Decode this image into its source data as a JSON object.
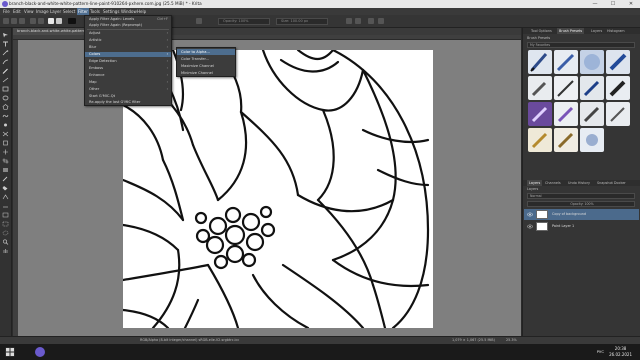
{
  "window": {
    "title": "branch-black-and-white-white-pattern-line-paint-910264-pxhere.com.jpg (25.5 MiB) * - Krita",
    "minimize": "—",
    "maximize": "☐",
    "close": "✕"
  },
  "menubar": {
    "items": [
      "File",
      "Edit",
      "View",
      "Image",
      "Layer",
      "Select",
      "Filter",
      "Tools",
      "Settings",
      "Window",
      "Help"
    ],
    "active": "Filter"
  },
  "toolbar": {
    "opacity_label": "Opacity: 100%",
    "size_label": "Size: 100.00 px"
  },
  "document_tab": {
    "label": "branch-black-and-white-white-pattern-line-paint-910264-pxhere.com.jpg"
  },
  "filter_menu": {
    "apply_again": "Apply Filter Again: Levels",
    "apply_again_shortcut": "Ctrl+F",
    "apply_prompting": "Apply Filter Again (Reprompt)",
    "items": [
      "Adjust",
      "Artistic",
      "Blur",
      "Colors",
      "Edge Detection",
      "Emboss",
      "Enhance",
      "Map",
      "Other",
      "Start G'MIC-Qt",
      "Re-apply the last G'MIC filter"
    ],
    "highlighted": "Colors"
  },
  "colors_submenu": {
    "items": [
      "Color to Alpha...",
      "Color Transfer...",
      "Maximize Channel",
      "Minimize Channel"
    ],
    "highlighted": "Color to Alpha..."
  },
  "dock": {
    "top_tabs": [
      "Tool Options",
      "Brush Presets",
      "Layers",
      "Histogram"
    ],
    "brush_presets_label": "Brush Presets",
    "tag_label": "My Favorites",
    "layer_tabs": [
      "Layers",
      "Channels",
      "Undo History",
      "Snapshot Docker"
    ],
    "layers_label": "Layers",
    "blend_mode": "Normal",
    "opacity": "Opacity: 100%",
    "layers": [
      {
        "name": "Copy of background",
        "active": true
      },
      {
        "name": "Paint Layer 1",
        "active": false
      }
    ]
  },
  "status": {
    "color_info": "RGB/Alpha (8-bit integer/channel)  sRGB-elle-V2-srgbtrc.icc",
    "doc_info": "1,079 × 1,067 (25.5 MiB)",
    "zoom": "25.3%"
  },
  "taskbar": {
    "language": "РУС",
    "time": "20:38",
    "date": "26.02.2021"
  },
  "colors": {
    "accent": "#4d6d8e",
    "canvas_bg": "#7f7f7f"
  }
}
